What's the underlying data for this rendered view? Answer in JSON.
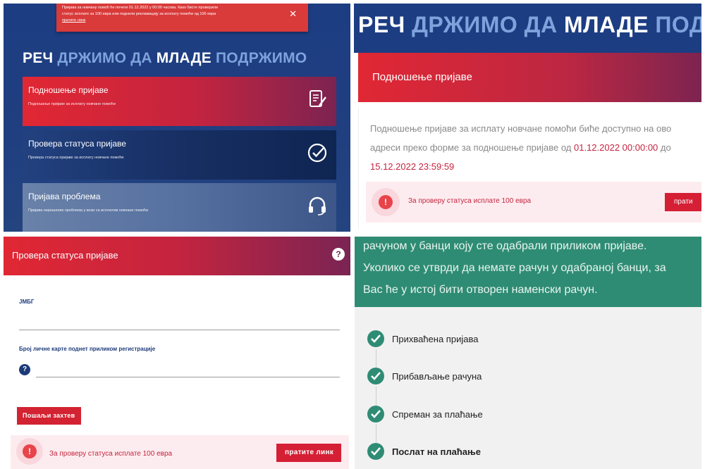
{
  "colors": {
    "navy": "#1c3d82",
    "red": "#e12734",
    "green": "#2f8c74",
    "light_blue_title": "#7ea3dc"
  },
  "panel1": {
    "alert_line1": "Пријава за новчану помоћ ће почети 01.12.2022 у 00:00 часова. Како бисте проверили",
    "alert_line2": "статус исплате за 100 евра или поднели рекламацију за исплату помоћи од 100 евра",
    "alert_link": "пратите линк",
    "alert_close": "✕",
    "title": {
      "w1": "РЕЧ ",
      "b1": "ДРЖИМО ДА ",
      "w2": "МЛАДЕ ",
      "b2": "ПОДРЖИМО"
    },
    "cards": [
      {
        "title": "Подношење пријаве",
        "subtitle": "Подношење пријаве за исплату новчане помоћи",
        "icon": "form-edit-icon"
      },
      {
        "title": "Провера статуса пријаве",
        "subtitle": "Провера статуса пријаве за исплату новчане помоћи",
        "icon": "check-circle-icon"
      },
      {
        "title": "Пријава проблема",
        "subtitle": "Пријава нерешених проблема у вези са исплатом новчане помоћи",
        "icon": "headset-icon"
      }
    ]
  },
  "panel2": {
    "title": {
      "w1": "РЕЧ ",
      "b1": "ДРЖИМО ДА ",
      "w2": "МЛАДЕ ",
      "b2": "ПОДРЖИ"
    },
    "bar_title": "Подношење пријаве",
    "text_part1": "Подношење пријаве за исплату новчане помоћи биће доступно на ово",
    "text_part2": "адреси преко форме за подношење пријаве од ",
    "date_from": "01.12.2022 00:00:00",
    "text_part3": " до",
    "date_to": "15.12.2022 23:59:59",
    "info_icon": "!",
    "info_text": "За проверу статуса исплате 100 евра",
    "info_button": "прати"
  },
  "panel3": {
    "bar_title": "Провера статуса пријаве",
    "help_icon": "?",
    "jmbg_label": "ЈМБГ",
    "id_label": "Број личне карте поднет приликом регистрације",
    "id_help": "?",
    "send_button": "Пошаљи захтев",
    "info_icon": "!",
    "info_text": "За проверу статуса исплате 100 евра",
    "info_button": "пратите линк"
  },
  "panel4": {
    "text_line1": "рачуном у банци коју сте одабрали приликом пријаве.",
    "text_line2": "Уколико се утврди да немате рачун у одабраној банци, за",
    "text_line3": "Вас ће у истој бити отворен наменски рачун.",
    "steps": [
      {
        "label": "Прихваћена пријава"
      },
      {
        "label": "Прибављање рачуна"
      },
      {
        "label": "Спреман за плаћање"
      },
      {
        "label": "Послат на плаћање"
      }
    ]
  }
}
